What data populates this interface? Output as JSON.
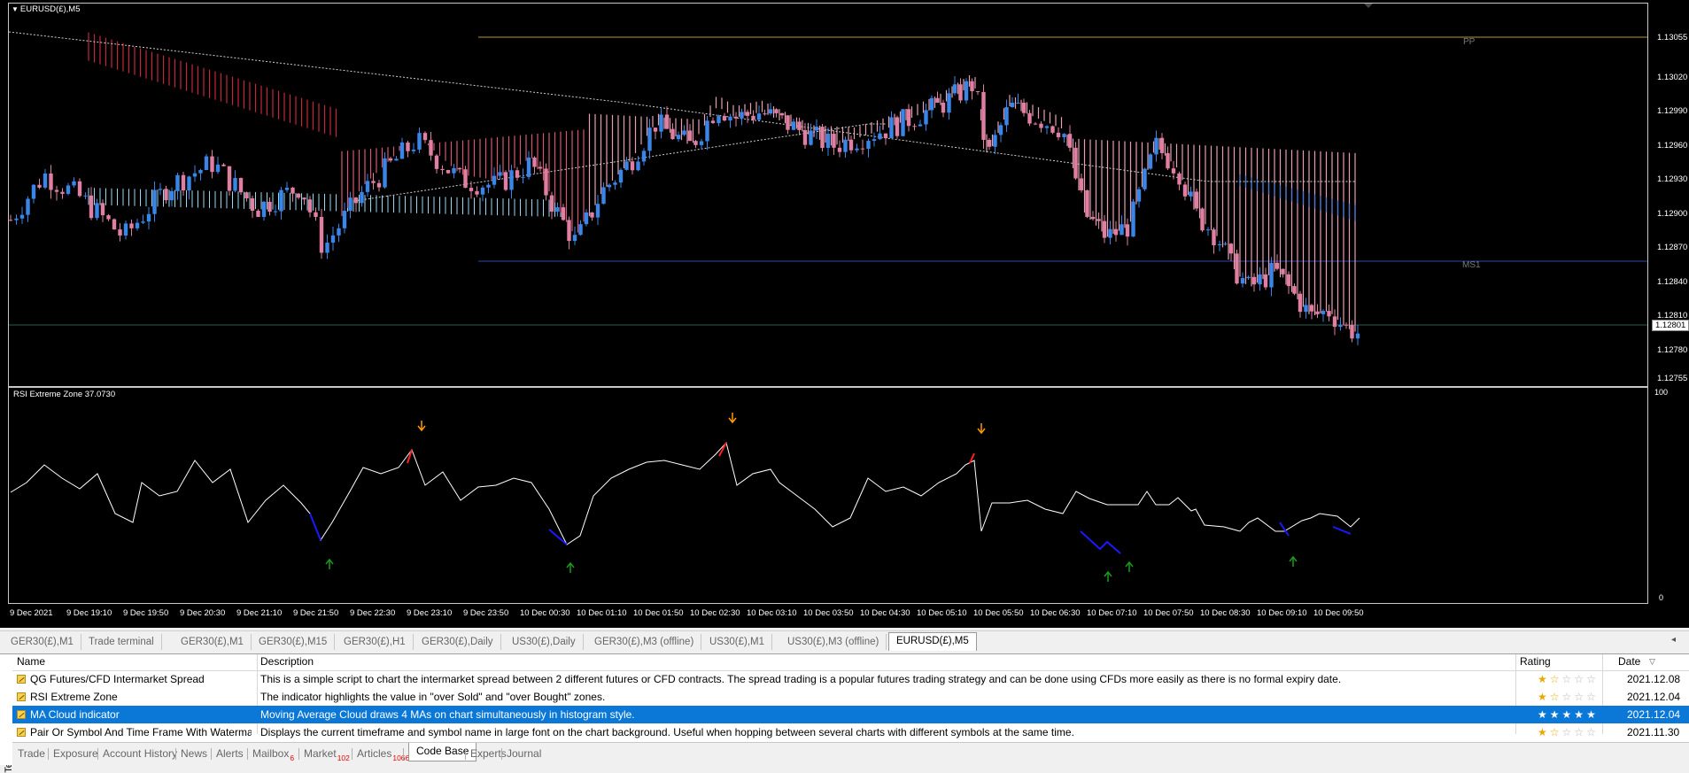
{
  "chart": {
    "symbol": "EURUSD(£),M5",
    "indicator_label": "RSI Extreme Zone 37.0730",
    "level_labels": {
      "pp": "PP",
      "ms1": "MS1"
    },
    "price_levels": [
      "1.13055",
      "1.13020",
      "1.12990",
      "1.12960",
      "1.12930",
      "1.12900",
      "1.12870",
      "1.12840",
      "1.12810",
      "1.12780",
      "1.12755"
    ],
    "current_price": "1.12801",
    "rsi_scale": {
      "top": "100",
      "bottom": "0"
    },
    "time_labels": [
      "9 Dec 2021",
      "9 Dec 19:10",
      "9 Dec 19:50",
      "9 Dec 20:30",
      "9 Dec 21:10",
      "9 Dec 21:50",
      "9 Dec 22:30",
      "9 Dec 23:10",
      "9 Dec 23:50",
      "10 Dec 00:30",
      "10 Dec 01:10",
      "10 Dec 01:50",
      "10 Dec 02:30",
      "10 Dec 03:10",
      "10 Dec 03:50",
      "10 Dec 04:30",
      "10 Dec 05:10",
      "10 Dec 05:50",
      "10 Dec 06:30",
      "10 Dec 07:10",
      "10 Dec 07:50",
      "10 Dec 08:30",
      "10 Dec 09:10",
      "10 Dec 09:50"
    ],
    "colors": {
      "bull": "#3a86e8",
      "bear": "#e07fa2",
      "pp_line": "#b59a2a",
      "ms1_line": "#2a4ab0",
      "bid_line": "#2f5a4a",
      "rsi_line": "#ffffff",
      "rsi_overbought": "#ff2020",
      "rsi_oversold": "#1a1aff",
      "arrow_down": "#ff9a00",
      "arrow_up": "#1c9a1c"
    }
  },
  "chart_tabs": [
    {
      "label": "GER30(£),M1"
    },
    {
      "label": "Trade terminal"
    },
    {
      "label": "GER30(£),M1"
    },
    {
      "label": "GER30(£),M15"
    },
    {
      "label": "GER30(£),H1"
    },
    {
      "label": "GER30(£),Daily"
    },
    {
      "label": "US30(£),Daily"
    },
    {
      "label": "GER30(£),M3 (offline)"
    },
    {
      "label": "US30(£),M1"
    },
    {
      "label": "US30(£),M3 (offline)"
    },
    {
      "label": "EURUSD(£),M5"
    }
  ],
  "terminal": {
    "side_label": "Terminal",
    "close_icon": "×",
    "columns": {
      "name": "Name",
      "description": "Description",
      "rating": "Rating",
      "date": "Date"
    },
    "rows": [
      {
        "name": "QG Futures/CFD Intermarket Spread",
        "description": "This is a simple script to chart the intermarket spread between 2 different futures or CFD contracts. The spread trading is a popular futures trading strategy and can be done using CFDs more easily as there is no formal expiry date.",
        "rating": 1.5,
        "date": "2021.12.08"
      },
      {
        "name": "RSI Extreme Zone",
        "description": "The indicator highlights the value in \"over Sold\" and \"over Bought\" zones.",
        "rating": 1.5,
        "date": "2021.12.04"
      },
      {
        "name": "MA Cloud indicator",
        "description": "Moving Average Cloud draws 4 MAs on chart simultaneously in histogram style.",
        "rating": 5,
        "date": "2021.12.04",
        "selected": true
      },
      {
        "name": "Pair Or Symbol And Time Frame With Watermark",
        "description": "Displays the current timeframe and symbol name in large font on the chart background. Useful when hopping between several charts with different symbols at the same time.",
        "rating": 1.5,
        "date": "2021.11.30"
      }
    ],
    "tabs": [
      {
        "label": "Trade"
      },
      {
        "label": "Exposure"
      },
      {
        "label": "Account History"
      },
      {
        "label": "News"
      },
      {
        "label": "Alerts"
      },
      {
        "label": "Mailbox",
        "badge": "6"
      },
      {
        "label": "Market",
        "badge": "102"
      },
      {
        "label": "Articles",
        "badge": "1066"
      },
      {
        "label": "Code Base",
        "active": true
      },
      {
        "label": "Experts"
      },
      {
        "label": "Journal"
      }
    ]
  }
}
